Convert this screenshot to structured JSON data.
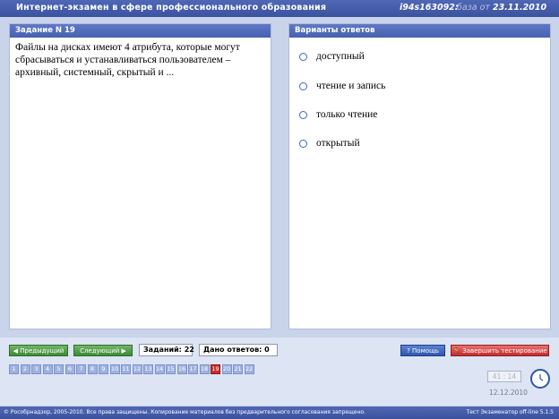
{
  "header": {
    "title": "Интернет-экзамен в сфере профессионального образования",
    "code": "i94s163092:",
    "base_label": "база от",
    "base_date": "23.11.2010"
  },
  "task": {
    "title": "Задание N 19",
    "question": "Файлы на дисках имеют 4 атрибута, которые могут сбрасываться и устанавливаться пользователем – архивный, системный, скрытый и ..."
  },
  "answers": {
    "title": "Варианты ответов",
    "options": [
      "доступный",
      "чтение и запись",
      "только чтение",
      "открытый"
    ]
  },
  "nav": {
    "prev_label": "Предыдущий",
    "next_label": "Следующий",
    "tasks_label": "Заданий:",
    "tasks_count": "22",
    "answered_label": "Дано ответов:",
    "answered_count": "0",
    "help_label": "Помощь",
    "finish_label": "Завершить тестирование",
    "task_numbers": [
      "1",
      "2",
      "3",
      "4",
      "5",
      "6",
      "7",
      "8",
      "9",
      "10",
      "11",
      "12",
      "13",
      "14",
      "15",
      "16",
      "17",
      "18",
      "19",
      "20",
      "21",
      "22"
    ],
    "active_task": "19"
  },
  "status": {
    "time": "41 : 14",
    "date": "12.12.2010"
  },
  "footer": {
    "left": "© Рособрнадзор, 2005-2010. Все права защищены. Копирование материалов без предварительного согласования запрещено.",
    "right": "Тест Экзаменатор off-line 5.1.5"
  },
  "icons": {
    "prev": "arrow-left-icon",
    "next": "arrow-right-icon",
    "help": "question-icon",
    "finish": "running-man-icon",
    "clock": "clock-icon"
  }
}
